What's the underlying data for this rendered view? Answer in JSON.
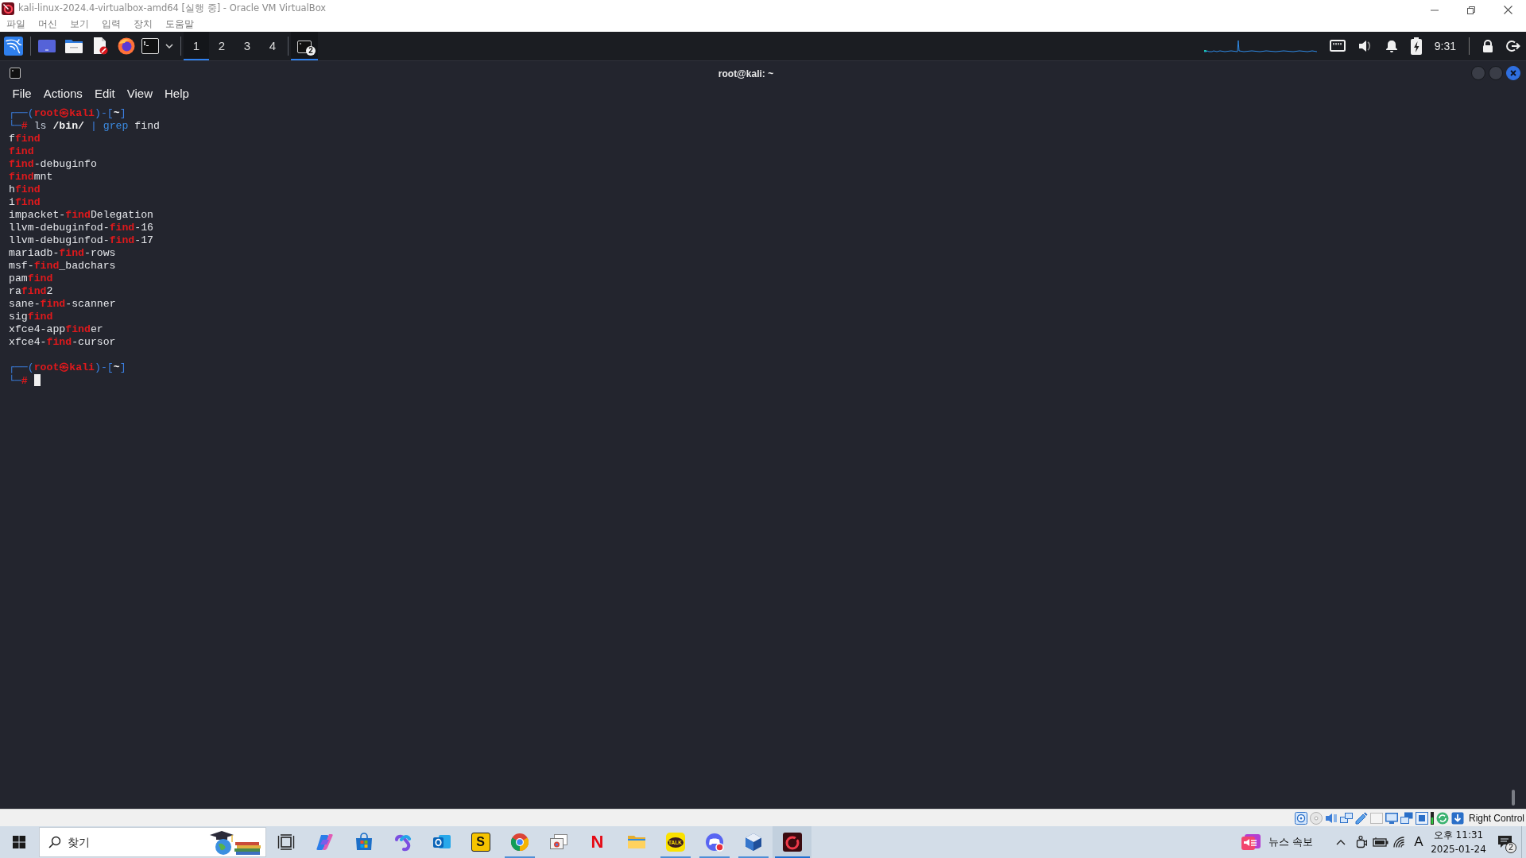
{
  "vbox_window": {
    "title": "kali-linux-2024.4-virtualbox-amd64 [실행 중] - Oracle VM VirtualBox",
    "menu": [
      "파일",
      "머신",
      "보기",
      "입력",
      "장치",
      "도움말"
    ]
  },
  "kali_panel": {
    "workspaces": [
      {
        "label": "1",
        "selected": true
      },
      {
        "label": "2",
        "selected": false
      },
      {
        "label": "3",
        "selected": false
      },
      {
        "label": "4",
        "selected": false
      }
    ],
    "tasks": [
      {
        "badge": "2",
        "selected": true
      }
    ],
    "clock": "9:31"
  },
  "terminal": {
    "title": "root@kali: ~",
    "menu": [
      "File",
      "Actions",
      "Edit",
      "View",
      "Help"
    ],
    "lines": [
      {
        "kind": "prompt",
        "segments": [
          {
            "text": "┌──(",
            "kind": "frame"
          },
          {
            "text": "root㉿kali",
            "kind": "user"
          },
          {
            "text": ")-[",
            "kind": "frame"
          },
          {
            "text": "~",
            "kind": "cwd"
          },
          {
            "text": "]",
            "kind": "frame"
          }
        ]
      },
      {
        "kind": "command",
        "segments": [
          {
            "text": "└─",
            "kind": "frame"
          },
          {
            "text": "#",
            "kind": "symbol"
          }
        ],
        "words": [
          {
            "text": "ls",
            "kind": "alias"
          },
          {
            "text": "/bin/",
            "kind": "path"
          },
          {
            "text": "|",
            "kind": "pipe"
          },
          {
            "text": "grep",
            "kind": "command"
          },
          {
            "text": "find",
            "kind": "arg"
          }
        ],
        "cursor": false
      },
      {
        "kind": "output",
        "text": "f**find**"
      },
      {
        "kind": "output",
        "text": "**find**"
      },
      {
        "kind": "output",
        "text": "**find**-debuginfo"
      },
      {
        "kind": "output",
        "text": "**find**mnt"
      },
      {
        "kind": "output",
        "text": "h**find**"
      },
      {
        "kind": "output",
        "text": "i**find**"
      },
      {
        "kind": "output",
        "text": "impacket-**find**Delegation"
      },
      {
        "kind": "output",
        "text": "llvm-debuginfod-**find**-16"
      },
      {
        "kind": "output",
        "text": "llvm-debuginfod-**find**-17"
      },
      {
        "kind": "output",
        "text": "mariadb-**find**-rows"
      },
      {
        "kind": "output",
        "text": "msf-**find**_badchars"
      },
      {
        "kind": "output",
        "text": "pam**find**"
      },
      {
        "kind": "output",
        "text": "ra**find**2"
      },
      {
        "kind": "output",
        "text": "sane-**find**-scanner"
      },
      {
        "kind": "output",
        "text": "sig**find**"
      },
      {
        "kind": "output",
        "text": "xfce4-app**find**er"
      },
      {
        "kind": "output",
        "text": "xfce4-**find**-cursor"
      },
      {
        "kind": "blank"
      },
      {
        "kind": "prompt",
        "segments": [
          {
            "text": "┌──(",
            "kind": "frame"
          },
          {
            "text": "root㉿kali",
            "kind": "user"
          },
          {
            "text": ")-[",
            "kind": "frame"
          },
          {
            "text": "~",
            "kind": "cwd"
          },
          {
            "text": "]",
            "kind": "frame"
          }
        ]
      },
      {
        "kind": "command",
        "segments": [
          {
            "text": "└─",
            "kind": "frame"
          },
          {
            "text": "#",
            "kind": "symbol"
          }
        ],
        "cursor": true
      }
    ]
  },
  "status_bar": {
    "host_key": "Right Control"
  },
  "taskbar": {
    "search": {
      "placeholder": "찾기"
    },
    "apps": [
      {
        "kind": "task-view",
        "running": false,
        "active": false
      },
      {
        "kind": "sparkle",
        "running": false,
        "active": false
      },
      {
        "kind": "store",
        "running": false,
        "active": false
      },
      {
        "kind": "loop",
        "running": false,
        "active": false
      },
      {
        "kind": "mail",
        "running": false,
        "active": false
      },
      {
        "kind": "letter-tile",
        "glyph": "S",
        "running": false,
        "active": false
      },
      {
        "kind": "browser",
        "running": true,
        "active": false
      },
      {
        "kind": "frames",
        "running": false,
        "active": false
      },
      {
        "kind": "letter",
        "glyph": "N",
        "running": false,
        "active": false
      },
      {
        "kind": "folder",
        "running": false,
        "active": false
      },
      {
        "kind": "chat-tile",
        "glyph": "TALK",
        "running": true,
        "active": false
      },
      {
        "kind": "controller",
        "running": true,
        "active": false
      },
      {
        "kind": "cube",
        "running": true,
        "active": false
      },
      {
        "kind": "vm-tile",
        "running": true,
        "active": true
      }
    ],
    "news": "뉴스 속보",
    "ime": "A",
    "time": "오후 11:31",
    "date": "2025-01-24",
    "notifications": "2"
  }
}
